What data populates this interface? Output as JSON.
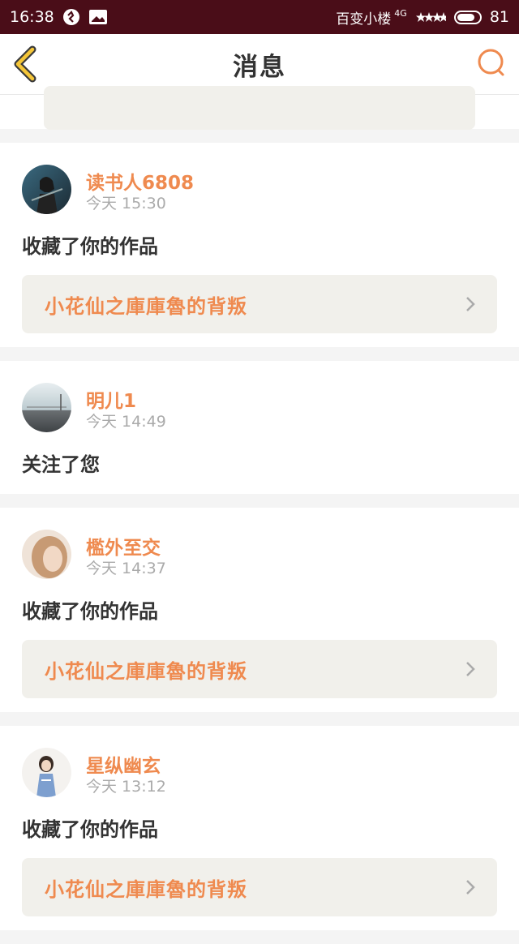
{
  "status_bar": {
    "time": "16:38",
    "network": "百变小楼",
    "signal": "4G",
    "battery": "81",
    "battery_level": 0.81
  },
  "header": {
    "title": "消息",
    "back_icon": "chevron-left-icon",
    "search_icon": "search-icon"
  },
  "colors": {
    "accent": "#ef8a4f",
    "status_bar": "#4a0d18",
    "card_link_bg": "#f1f0eb"
  },
  "messages": [
    {
      "username": "读书人6808",
      "time": "今天 15:30",
      "action": "收藏了你的作品",
      "work_title": "小花仙之庫庫魯的背叛"
    },
    {
      "username": "明儿1",
      "time": "今天 14:49",
      "action": "关注了您"
    },
    {
      "username": "檻外至交",
      "time": "今天 14:37",
      "action": "收藏了你的作品",
      "work_title": "小花仙之庫庫魯的背叛"
    },
    {
      "username": "星纵幽玄",
      "time": "今天 13:12",
      "action": "收藏了你的作品",
      "work_title": "小花仙之庫庫魯的背叛"
    }
  ]
}
